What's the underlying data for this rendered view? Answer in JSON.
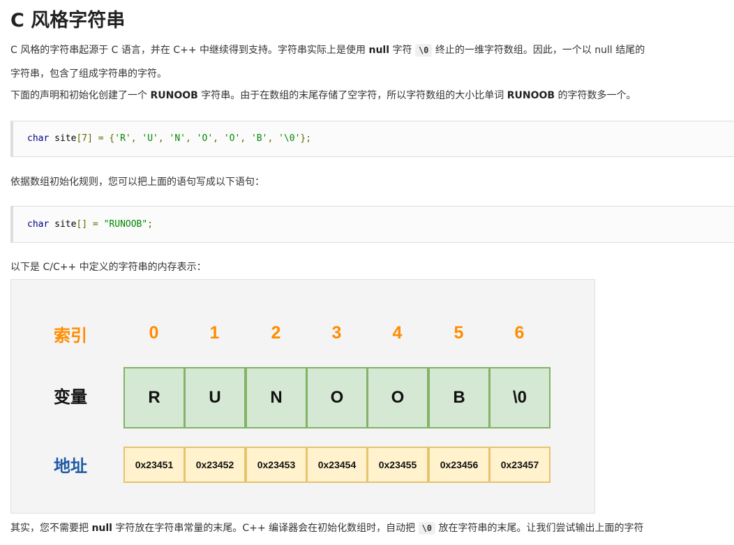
{
  "title": "C 风格字符串",
  "p1": {
    "line1_a": "C 风格的字符串起源于 C 语言，并在 C++ 中继续得到支持。字符串实际上是使用 ",
    "null": "null",
    "line1_b": " 字符 ",
    "code": "\\0",
    "line1_c": " 终止的一维字符数组。因此，一个以 null 结尾的",
    "line2": "字符串，包含了组成字符串的字符。"
  },
  "p2": {
    "a": "下面的声明和初始化创建了一个 ",
    "runoob1": "RUNOOB",
    "b": " 字符串。由于在数组的末尾存储了空字符，所以字符数组的大小比单词 ",
    "runoob2": "RUNOOB",
    "c": " 的字符数多一个。"
  },
  "code1": {
    "kw": "char",
    "ident": " site",
    "punc1": "[7] = {",
    "s1": "'R'",
    "s2": "'U'",
    "s3": "'N'",
    "s4": "'O'",
    "s5": "'O'",
    "s6": "'B'",
    "s7": "'\\0'",
    "comma": ", ",
    "end": "};"
  },
  "p3": "依据数组初始化规则，您可以把上面的语句写成以下语句：",
  "code2": {
    "kw": "char",
    "ident": " site",
    "punc": "[] = ",
    "str": "\"RUNOOB\"",
    "end": ";"
  },
  "p4": "以下是 C/C++ 中定义的字符串的内存表示：",
  "diagram": {
    "index_label": "索引",
    "var_label": "变量",
    "addr_label": "地址",
    "indices": [
      "0",
      "1",
      "2",
      "3",
      "4",
      "5",
      "6"
    ],
    "values": [
      "R",
      "U",
      "N",
      "O",
      "O",
      "B",
      "\\0"
    ],
    "addresses": [
      "0x23451",
      "0x23452",
      "0x23453",
      "0x23454",
      "0x23455",
      "0x23456",
      "0x23457"
    ],
    "colors": {
      "index": "#ff8c00",
      "var_label": "#111111",
      "addr_label": "#1f5aa6",
      "var_fill": "#d5e8d4",
      "var_border": "#82b366",
      "addr_fill": "#fff2cc",
      "addr_border": "#e6c36d"
    }
  },
  "p5": {
    "a": "其实，您不需要把 ",
    "null": "null",
    "b": " 字符放在字符串常量的末尾。C++ 编译器会在初始化数组时，自动把 ",
    "code": "\\0",
    "c": " 放在字符串的末尾。让我们尝试输出上面的字符"
  }
}
